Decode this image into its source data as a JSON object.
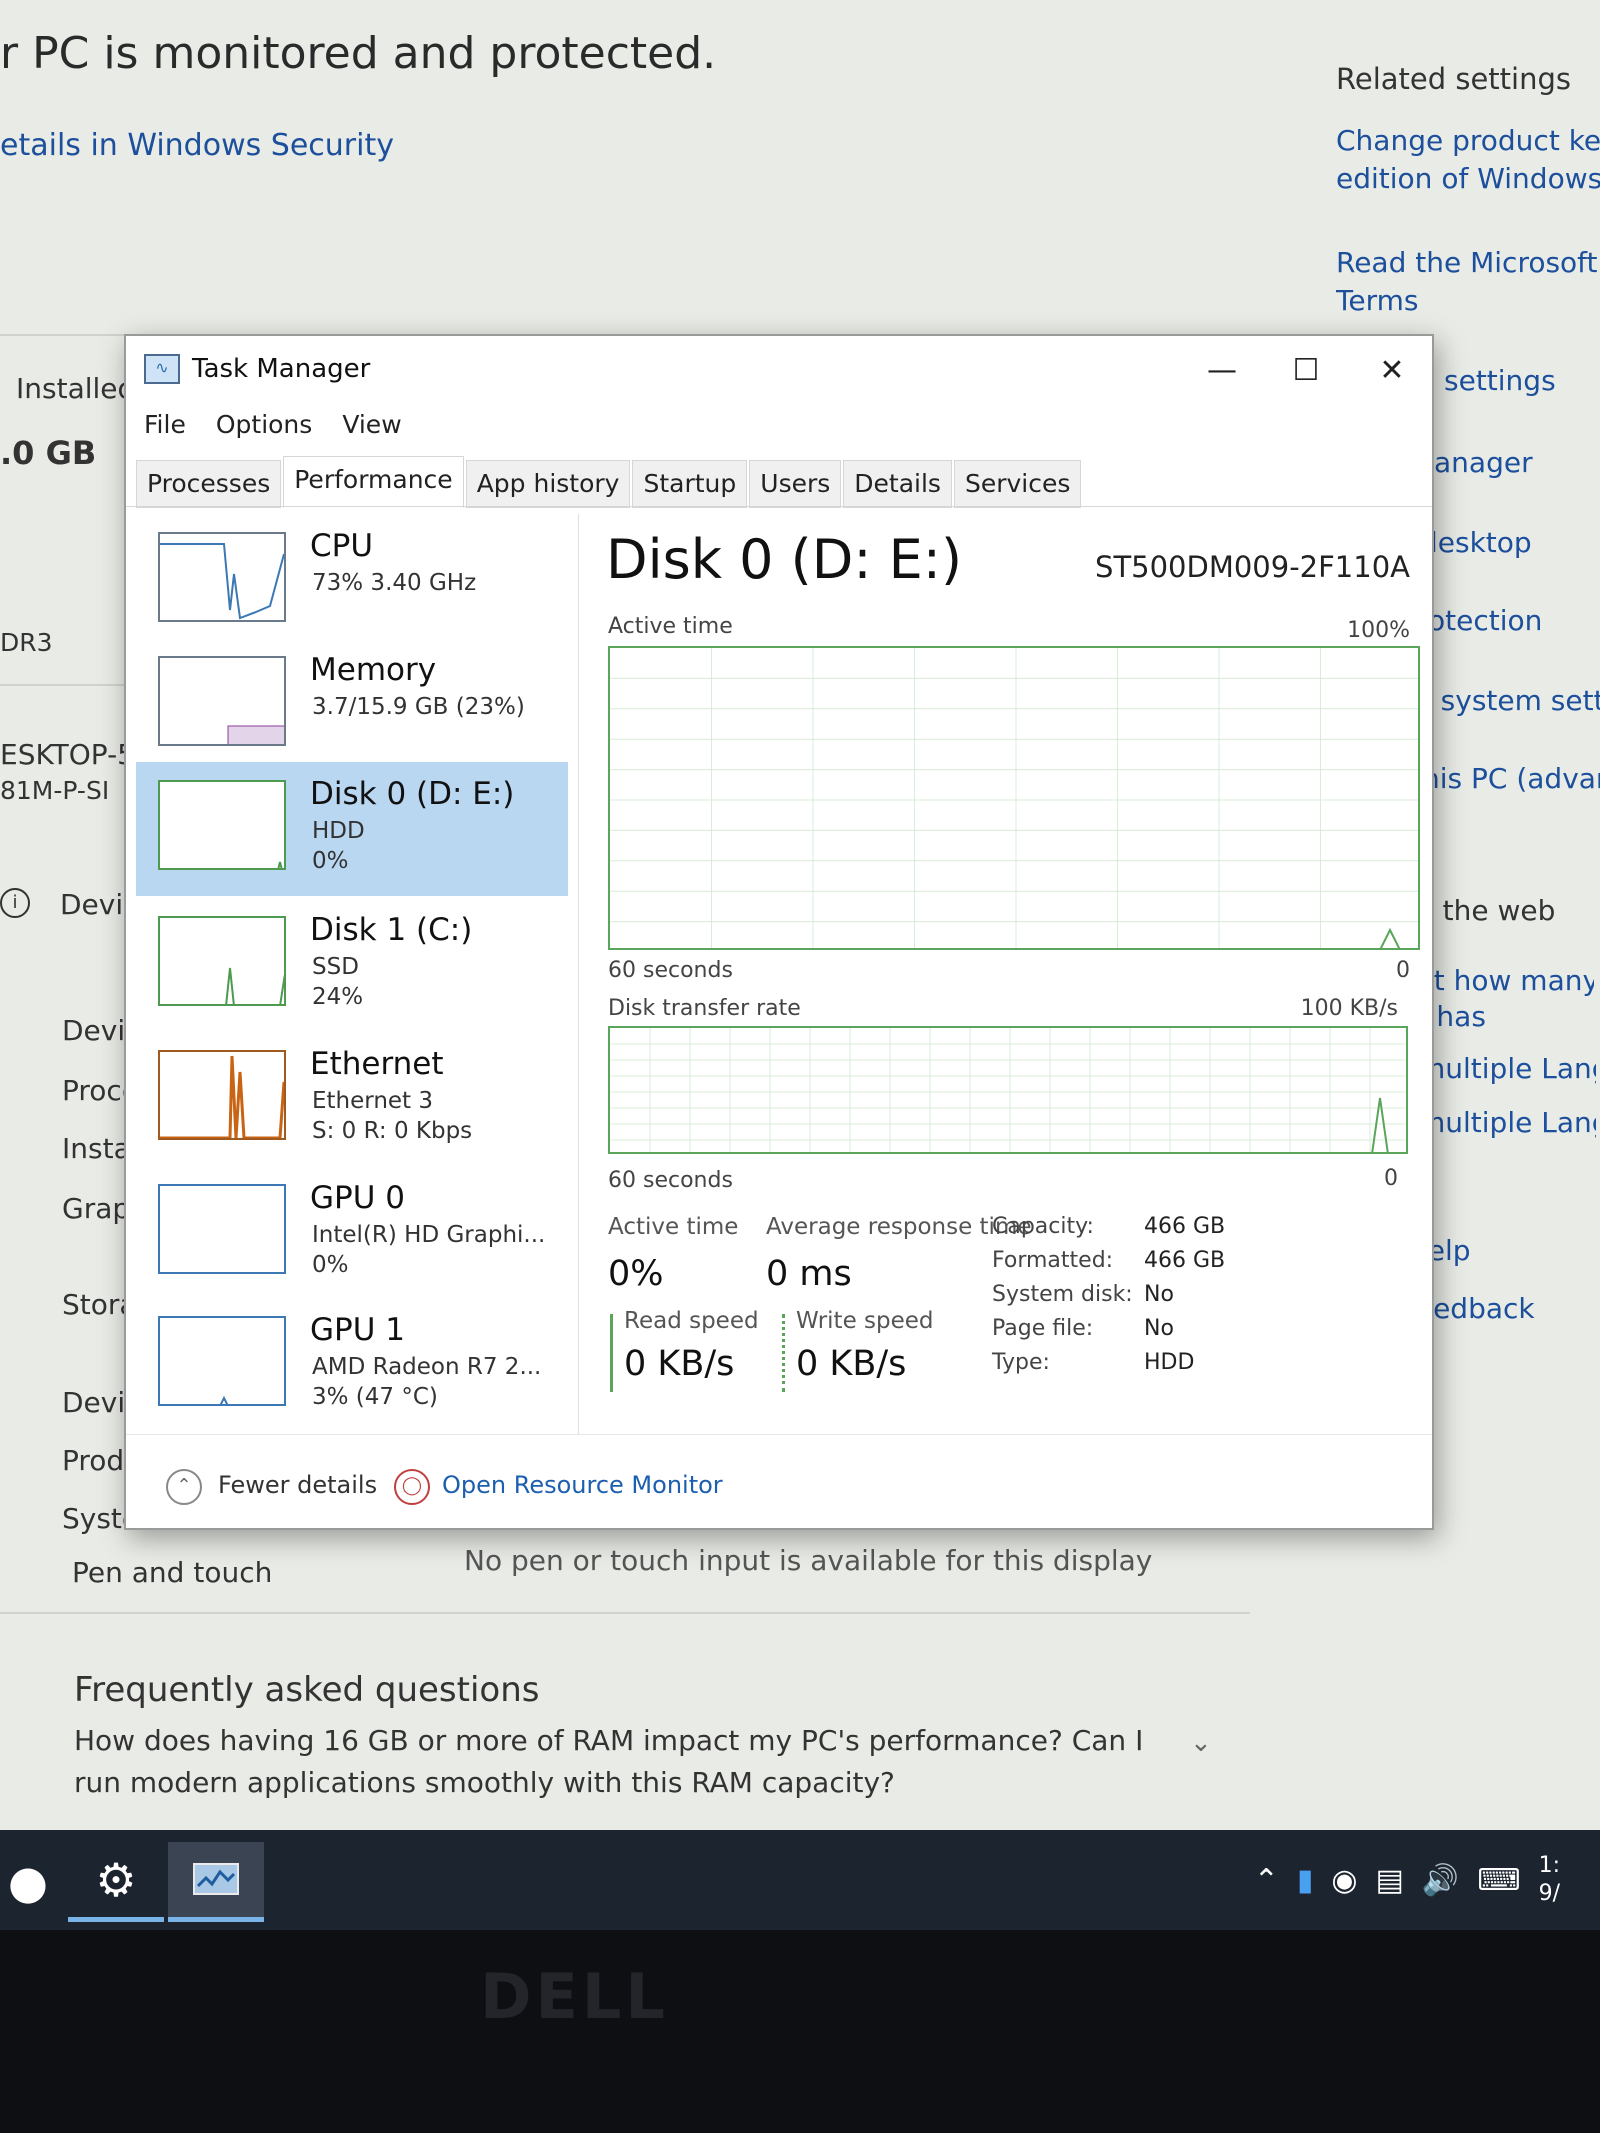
{
  "background": {
    "title": "r PC is monitored and protected.",
    "security_link": "etails in Windows Security",
    "installed_label": "Installed",
    "ram_value": ".0 GB",
    "ddr_label": "DR3",
    "device_name": "ESKTOP-5",
    "board": "81M-P-SI",
    "device_spec_head": "Devic",
    "rows": [
      "Devic",
      "Proce",
      "Instal",
      "Graph",
      "Stora",
      "Devic",
      "Produ",
      "Syste"
    ],
    "pen_touch_label": "Pen and touch",
    "pen_touch_value": "No pen or touch input is available for this display",
    "faq_heading": "Frequently asked questions",
    "faq_question": "How does having 16 GB or more of RAM impact my PC's performance? Can I run modern applications smoothly with this RAM capacity?",
    "related_settings": "Related settings",
    "related_links": [
      "Change product key o",
      "edition of Windows",
      "Read the Microsoft So",
      "Terms"
    ],
    "right_items": [
      "settings",
      "anager",
      "lesktop",
      "otection",
      "l system settin",
      "his PC (advanc",
      "n the web",
      "ut how many co",
      "r has",
      "multiple Langu",
      "multiple Langu",
      "help",
      "feedback"
    ]
  },
  "taskbar": {
    "apps": [
      "browser-icon",
      "settings-gear-icon",
      "task-manager-icon"
    ],
    "tray_clock": "1:",
    "tray_date": "9/"
  },
  "monitor_brand": "DELL",
  "task_manager": {
    "title": "Task Manager",
    "menu": [
      "File",
      "Options",
      "View"
    ],
    "tabs": [
      "Processes",
      "Performance",
      "App history",
      "Startup",
      "Users",
      "Details",
      "Services"
    ],
    "active_tab": "Performance",
    "sidebar": [
      {
        "name": "CPU",
        "line1": "73% 3.40 GHz",
        "line2": ""
      },
      {
        "name": "Memory",
        "line1": "3.7/15.9 GB (23%)",
        "line2": ""
      },
      {
        "name": "Disk 0 (D: E:)",
        "line1": "HDD",
        "line2": "0%"
      },
      {
        "name": "Disk 1 (C:)",
        "line1": "SSD",
        "line2": "24%"
      },
      {
        "name": "Ethernet",
        "line1": "Ethernet 3",
        "line2": "S: 0 R: 0 Kbps"
      },
      {
        "name": "GPU 0",
        "line1": "Intel(R) HD Graphi...",
        "line2": "0%"
      },
      {
        "name": "GPU 1",
        "line1": "AMD Radeon R7 2...",
        "line2": "3% (47 °C)"
      }
    ],
    "selected_index": 2,
    "detail": {
      "title": "Disk 0 (D: E:)",
      "model": "ST500DM009-2F110A",
      "active_time_label": "Active time",
      "active_time_max": "100%",
      "graph1_left": "60 seconds",
      "graph1_right": "0",
      "transfer_label": "Disk transfer rate",
      "transfer_max": "100 KB/s",
      "graph2_left": "60 seconds",
      "graph2_right": "0",
      "stats": {
        "active_time_label": "Active time",
        "active_time_value": "0%",
        "avg_response_label": "Average response time",
        "avg_response_value": "0 ms",
        "read_label": "Read speed",
        "read_value": "0 KB/s",
        "write_label": "Write speed",
        "write_value": "0 KB/s"
      },
      "properties": [
        {
          "key": "Capacity:",
          "value": "466 GB"
        },
        {
          "key": "Formatted:",
          "value": "466 GB"
        },
        {
          "key": "System disk:",
          "value": "No"
        },
        {
          "key": "Page file:",
          "value": "No"
        },
        {
          "key": "Type:",
          "value": "HDD"
        }
      ]
    },
    "footer": {
      "fewer_details": "Fewer details",
      "resource_monitor": "Open Resource Monitor"
    }
  },
  "colors": {
    "selected_bg": "#bad7f2",
    "disk_graph": "#5aa55a",
    "link": "#1c4f9c",
    "ethernet_graph": "#c86414",
    "cpu_graph": "#3c78b4"
  }
}
